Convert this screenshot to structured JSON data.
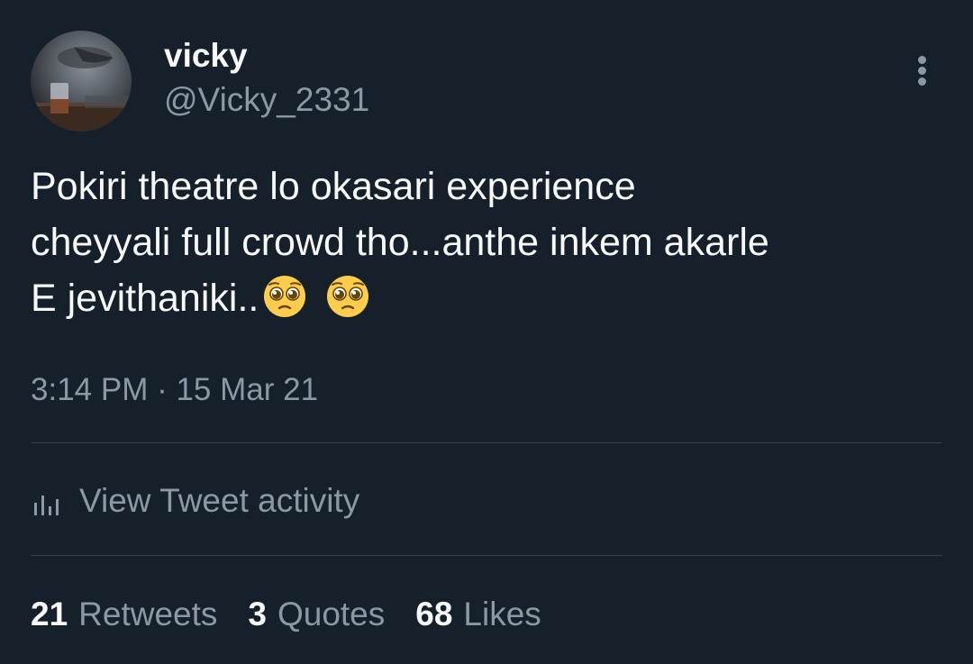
{
  "author": {
    "display_name": "vicky",
    "handle": "@Vicky_2331",
    "avatar": "avatar-photo-glass-on-table"
  },
  "menu": {
    "icon": "more-vertical-icon"
  },
  "tweet": {
    "lines": [
      "Pokiri theatre lo okasari experience",
      "cheyyali full crowd tho...anthe inkem akarle",
      "E jevithaniki.."
    ],
    "emojis": [
      "pleading-face-emoji",
      "pleading-face-emoji"
    ]
  },
  "meta": {
    "time": "3:14 PM",
    "separator": " · ",
    "date": "15 Mar 21"
  },
  "activity": {
    "icon": "bar-chart-icon",
    "label": "View Tweet activity"
  },
  "stats": [
    {
      "count": "21",
      "label": "Retweets"
    },
    {
      "count": "3",
      "label": "Quotes"
    },
    {
      "count": "68",
      "label": "Likes"
    }
  ],
  "colors": {
    "background": "#15202b",
    "primary_text": "#f7f9f9",
    "secondary_text": "#8b98a5",
    "divider": "#38444d"
  }
}
